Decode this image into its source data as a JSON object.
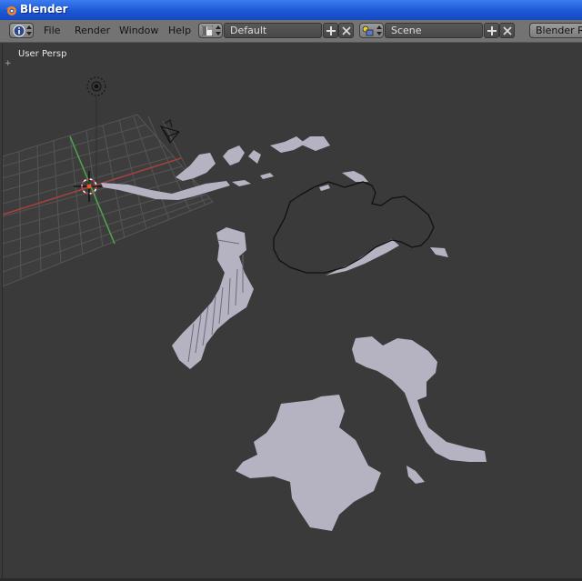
{
  "window": {
    "title": "Blender"
  },
  "menu": {
    "info_icon": "info-icon",
    "items": [
      "File",
      "Render",
      "Window",
      "Help"
    ]
  },
  "layout": {
    "value": "Default"
  },
  "scene": {
    "value": "Scene"
  },
  "engine": {
    "value": "Blender Render"
  },
  "viewport": {
    "label": "User Persp"
  },
  "colors": {
    "titlebar": "#1c58d6",
    "header": "#737373",
    "viewport": "#3a3a3a",
    "mesh": "#b5b3c2"
  }
}
